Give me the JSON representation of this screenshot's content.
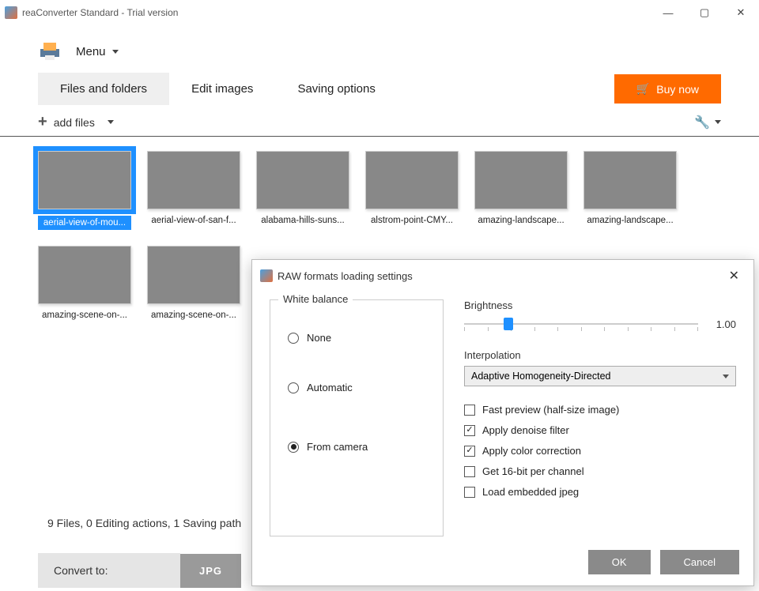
{
  "window": {
    "title": "reaConverter Standard - Trial version"
  },
  "menu": {
    "label": "Menu"
  },
  "tabs": {
    "files": "Files and folders",
    "edit": "Edit images",
    "saving": "Saving options",
    "buy": "Buy now"
  },
  "toolbar": {
    "add_files": "add files"
  },
  "thumbs": [
    {
      "caption": "aerial-view-of-mou...",
      "cls": "g1",
      "selected": true
    },
    {
      "caption": "aerial-view-of-san-f...",
      "cls": "g2"
    },
    {
      "caption": "alabama-hills-suns...",
      "cls": "g3"
    },
    {
      "caption": "alstrom-point-CMY...",
      "cls": "g4"
    },
    {
      "caption": "amazing-landscape...",
      "cls": "g5"
    },
    {
      "caption": "amazing-landscape...",
      "cls": "g6"
    },
    {
      "caption": "amazing-scene-on-...",
      "cls": "g7"
    },
    {
      "caption": "amazing-scene-on-...",
      "cls": "g8"
    }
  ],
  "status": "9 Files, 0 Editing actions, 1 Saving path",
  "convert": {
    "label": "Convert to:",
    "format": "JPG"
  },
  "dialog": {
    "title": "RAW formats loading settings",
    "white_balance": {
      "legend": "White balance",
      "none": "None",
      "automatic": "Automatic",
      "from_camera": "From camera",
      "selected": "from_camera"
    },
    "brightness": {
      "label": "Brightness",
      "value": "1.00"
    },
    "interpolation": {
      "label": "Interpolation",
      "value": "Adaptive Homogeneity-Directed"
    },
    "checks": {
      "fast_preview": {
        "label": "Fast preview (half-size image)",
        "checked": false
      },
      "denoise": {
        "label": "Apply denoise filter",
        "checked": true
      },
      "color_correction": {
        "label": "Apply color correction",
        "checked": true
      },
      "sixteen_bit": {
        "label": "Get 16-bit per channel",
        "checked": false
      },
      "embedded_jpeg": {
        "label": "Load embedded jpeg",
        "checked": false
      }
    },
    "buttons": {
      "ok": "OK",
      "cancel": "Cancel"
    }
  }
}
